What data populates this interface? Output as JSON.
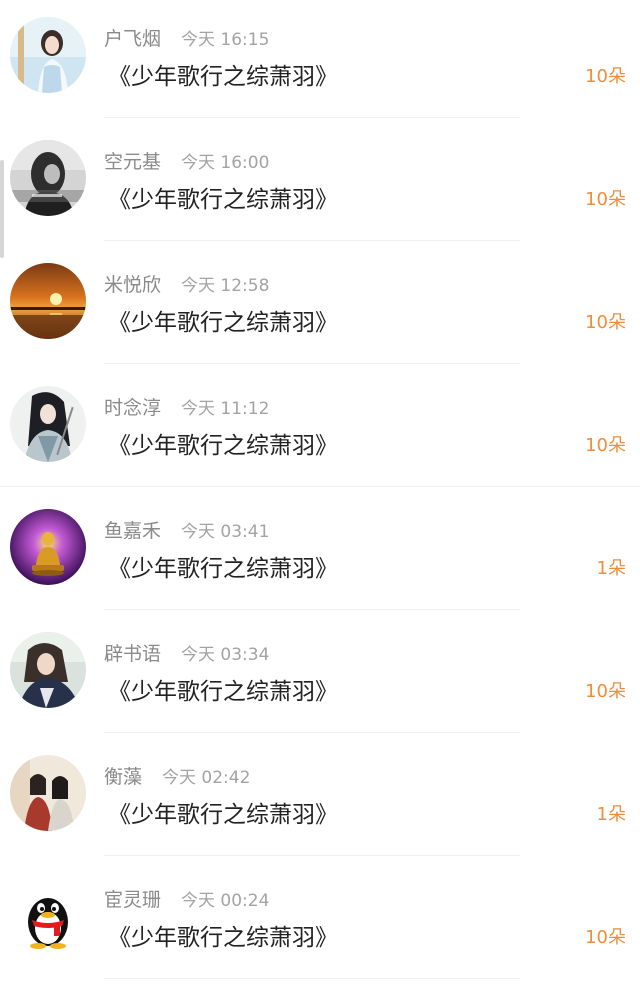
{
  "rows": [
    {
      "name": "户飞烟",
      "time": "今天 16:15",
      "title": "《少年歌行之综萧羽》",
      "count": "10朵",
      "avatar": "girl-portrait"
    },
    {
      "name": "空元基",
      "time": "今天 16:00",
      "title": "《少年歌行之综萧羽》",
      "count": "10朵",
      "avatar": "grayscale-portrait"
    },
    {
      "name": "米悦欣",
      "time": "今天 12:58",
      "title": "《少年歌行之综萧羽》",
      "count": "10朵",
      "avatar": "sunset"
    },
    {
      "name": "时念淳",
      "time": "今天 11:12",
      "title": "《少年歌行之综萧羽》",
      "count": "10朵",
      "avatar": "swordsman"
    },
    {
      "name": "鱼嘉禾",
      "time": "今天 03:41",
      "title": "《少年歌行之综萧羽》",
      "count": "1朵",
      "avatar": "golden-buddha"
    },
    {
      "name": "辟书语",
      "time": "今天 03:34",
      "title": "《少年歌行之综萧羽》",
      "count": "10朵",
      "avatar": "woman-portrait"
    },
    {
      "name": "衡藻",
      "time": "今天 02:42",
      "title": "《少年歌行之综萧羽》",
      "count": "1朵",
      "avatar": "couple-painting"
    },
    {
      "name": "宦灵珊",
      "time": "今天 00:24",
      "title": "《少年歌行之综萧羽》",
      "count": "10朵",
      "avatar": "qq-penguin"
    }
  ],
  "colors": {
    "accent": "#f08d3a",
    "title_text": "#222222",
    "meta_text": "#8e8e8e",
    "divider": "#f1f1f1"
  }
}
